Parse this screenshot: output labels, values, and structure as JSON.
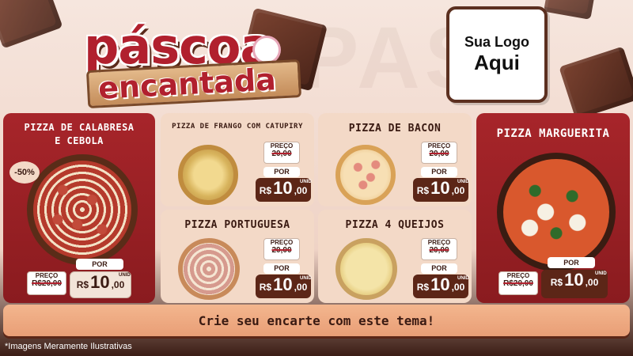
{
  "header": {
    "title_line1": "páscoa",
    "title_line2": "encantada",
    "logo_line1": "Sua Logo",
    "logo_line2": "Aqui"
  },
  "featured_left": {
    "name": "PIZZA DE CALABRESA E CEBOLA",
    "discount": "-50%",
    "old_label": "PREÇO",
    "old_price": "R$20,00",
    "por_label": "POR",
    "currency": "R$",
    "price_int": "10",
    "price_dec": ",00",
    "unit": "UNID"
  },
  "items": [
    {
      "name": "PIZZA DE FRANGO COM CATUPIRY",
      "old_label": "PREÇO",
      "old_price": "20,00",
      "por_label": "POR",
      "currency": "R$",
      "price_int": "10",
      "price_dec": ",00",
      "unit": "UNID"
    },
    {
      "name": "PIZZA DE BACON",
      "old_label": "PREÇO",
      "old_price": "20,00",
      "por_label": "POR",
      "currency": "R$",
      "price_int": "10",
      "price_dec": ",00",
      "unit": "UNID"
    },
    {
      "name": "PIZZA PORTUGUESA",
      "old_label": "PREÇO",
      "old_price": "20,00",
      "por_label": "POR",
      "currency": "R$",
      "price_int": "10",
      "price_dec": ",00",
      "unit": "UNID"
    },
    {
      "name": "PIZZA 4 QUEIJOS",
      "old_label": "PREÇO",
      "old_price": "20,00",
      "por_label": "POR",
      "currency": "R$",
      "price_int": "10",
      "price_dec": ",00",
      "unit": "UNID"
    }
  ],
  "featured_right": {
    "name": "PIZZA MARGUERITA",
    "old_label": "PREÇO",
    "old_price": "R$20,00",
    "por_label": "POR",
    "currency": "R$",
    "price_int": "10",
    "price_dec": ",00",
    "unit": "UNID"
  },
  "banner": {
    "text": "Crie seu encarte com este tema!"
  },
  "footer": {
    "disclaimer": "*Imagens Meramente Ilustrativas"
  },
  "colors": {
    "brand_red": "#b1202e",
    "chocolate": "#5c2617",
    "cream": "#f3d9c7"
  }
}
